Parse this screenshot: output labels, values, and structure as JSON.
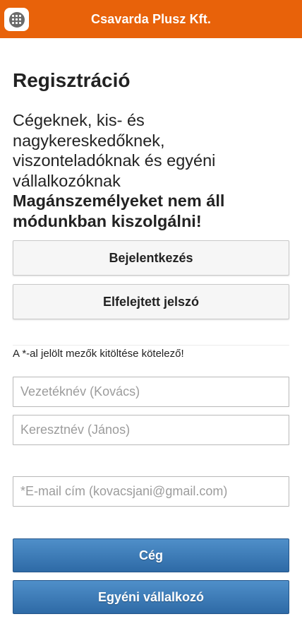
{
  "header": {
    "title": "Csavarda Plusz Kft.",
    "menu_icon": "grid-menu-icon"
  },
  "page": {
    "title": "Regisztráció",
    "intro": "Cégeknek, kis- és nagykereskedőknek, viszonteladóknak és egyéni vállalkozóknak",
    "intro_strong": "Magánszemélyeket nem áll módunkban kiszolgálni!"
  },
  "buttons": {
    "login": "Bejelentkezés",
    "forgot_password": "Elfelejtett jelszó",
    "company": "Cég",
    "sole_trader": "Egyéni vállalkozó"
  },
  "form": {
    "required_note": "A *-al jelölt mezők kitöltése kötelező!",
    "last_name_placeholder": "Vezetéknév (Kovács)",
    "first_name_placeholder": "Keresztnév (János)",
    "email_placeholder": "*E-mail cím (kovacsjani@gmail.com)"
  },
  "colors": {
    "header_bg": "#e8620a",
    "primary_button": "#3b7bb8"
  }
}
